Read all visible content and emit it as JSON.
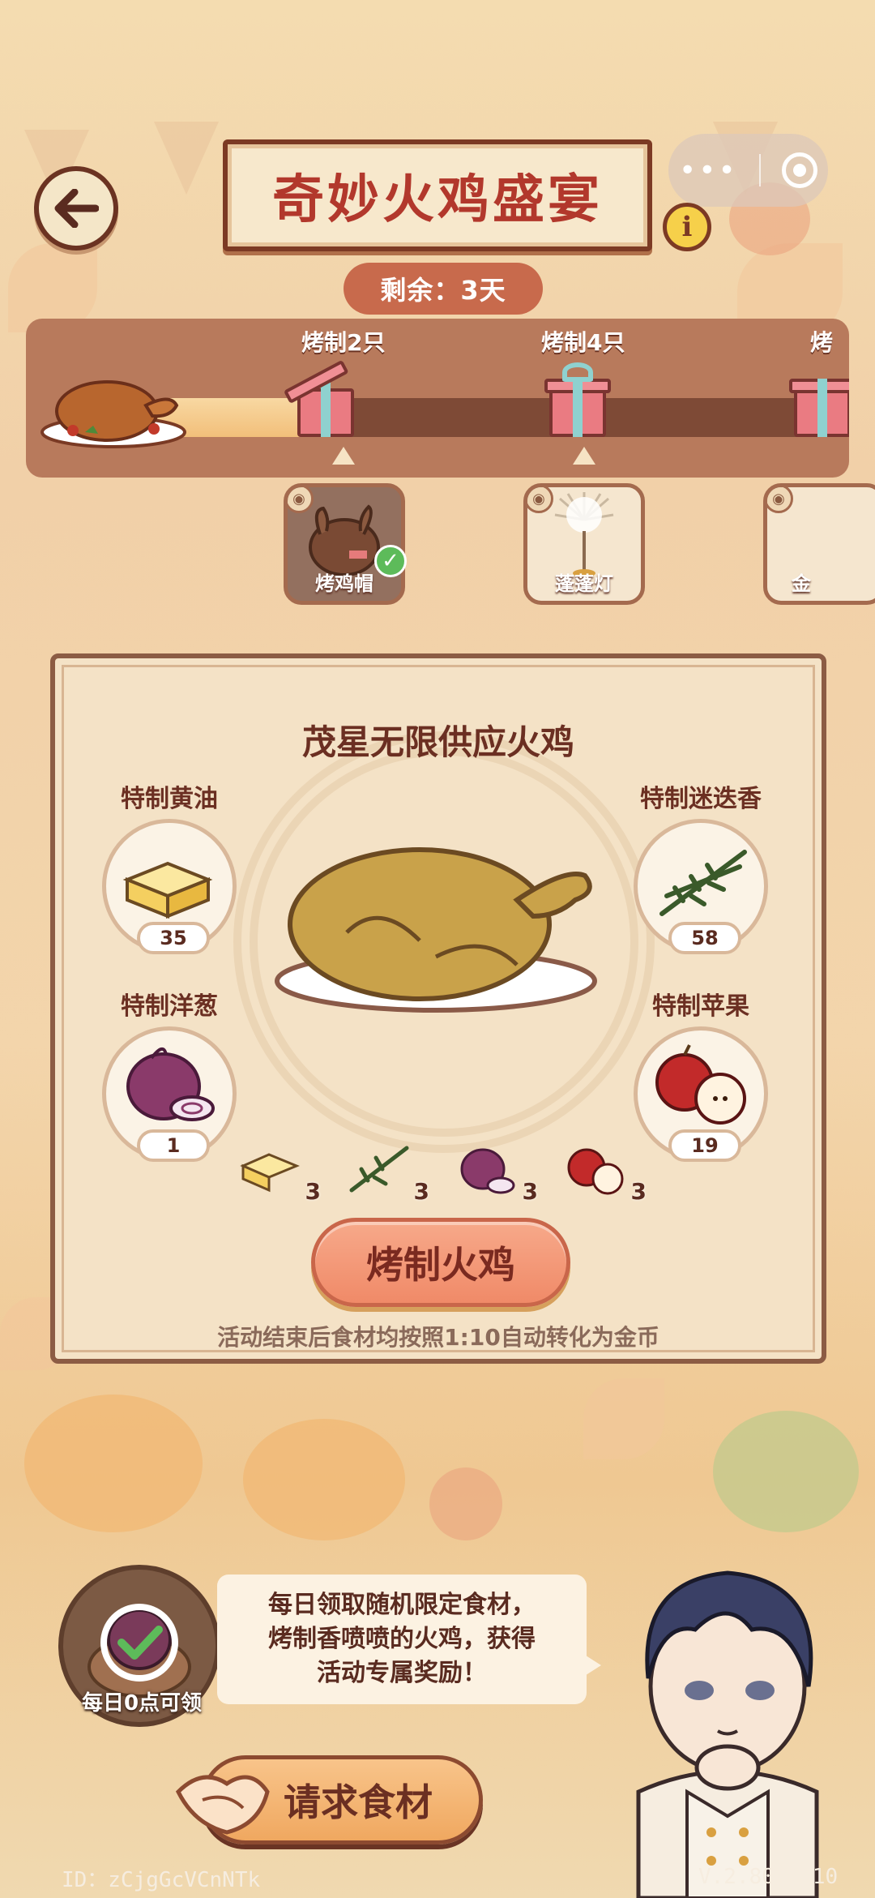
{
  "header": {
    "title": "奇妙火鸡盛宴",
    "remaining": "剩余：3天",
    "info_icon": "i"
  },
  "progress": {
    "fill_fraction": 0.25,
    "milestones": [
      {
        "label": "烤制2只",
        "state": "opened"
      },
      {
        "label": "烤制4只",
        "state": "locked"
      },
      {
        "label": "烤",
        "state": "locked"
      }
    ]
  },
  "rewards": [
    {
      "label": "烤鸡帽",
      "owned": true
    },
    {
      "label": "蓬蓬灯",
      "owned": false
    },
    {
      "label": "金",
      "owned": false
    }
  ],
  "panel": {
    "title": "茂星无限供应火鸡",
    "ingredients": [
      {
        "name": "特制黄油",
        "count": "35",
        "icon": "butter-icon"
      },
      {
        "name": "特制迷迭香",
        "count": "58",
        "icon": "rosemary-icon"
      },
      {
        "name": "特制洋葱",
        "count": "1",
        "icon": "onion-icon"
      },
      {
        "name": "特制苹果",
        "count": "19",
        "icon": "apple-icon"
      }
    ],
    "costs": [
      "3",
      "3",
      "3",
      "3"
    ],
    "roast_button": "烤制火鸡",
    "note": "活动结束后食材均按照1:10自动转化为金币"
  },
  "daily": {
    "label": "每日0点可领",
    "bubble_lines": [
      "每日领取随机限定食材，",
      "烤制香喷喷的火鸡，获得",
      "活动专属奖励！"
    ],
    "request_button": "请求食材"
  },
  "footer": {
    "id": "ID：zCjgGcVCnNTk",
    "version": "V.2.80.0_10"
  },
  "colors": {
    "title_red": "#b2382c",
    "button_orange": "#f08a68",
    "panel_bg": "#f4e2c6"
  }
}
